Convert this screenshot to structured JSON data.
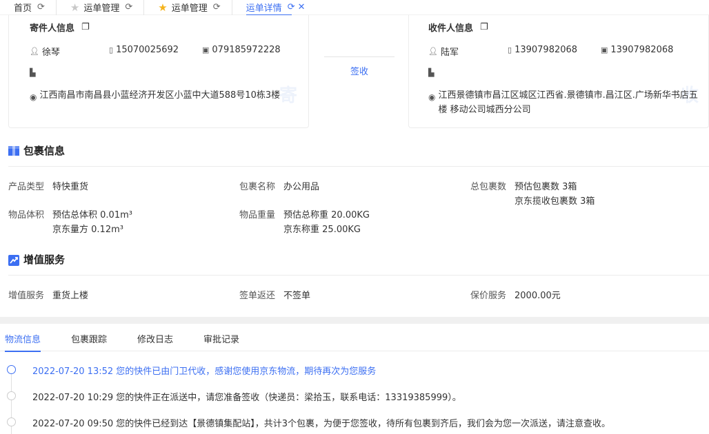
{
  "tabs": [
    {
      "label": "首页",
      "star": "none"
    },
    {
      "label": "运单管理",
      "star": "grey"
    },
    {
      "label": "运单管理",
      "star": "gold"
    },
    {
      "label": "运单详情",
      "star": "none",
      "active": true
    }
  ],
  "sender": {
    "title": "寄件人信息",
    "name": "徐琴",
    "mobile": "15070025692",
    "phone": "079185972228",
    "address": "江西南昌市南昌县小蓝经济开发区小蓝中大道588号10栋3楼",
    "watermark": "寄"
  },
  "receiver": {
    "title": "收件人信息",
    "name": "陆军",
    "mobile": "13907982068",
    "phone": "13907982068",
    "address": "江西景德镇市昌江区城区江西省.景德镇市.昌江区.广场新华书店五楼 移动公司城西分公司",
    "watermark": "收"
  },
  "status": {
    "label": "签收"
  },
  "package": {
    "title": "包裹信息",
    "product_type_k": "产品类型",
    "product_type_v": "特快重货",
    "name_k": "包裹名称",
    "name_v": "办公用品",
    "count_k": "总包裹数",
    "count_v1": "预估包裹数 3箱",
    "count_v2": "京东揽收包裹数 3箱",
    "volume_k": "物品体积",
    "volume_v1": "预估总体积 0.01m³",
    "volume_v2": "京东量方 0.12m³",
    "weight_k": "物品重量",
    "weight_v1": "预估总称重 20.00KG",
    "weight_v2": "京东称重 25.00KG"
  },
  "value_added": {
    "title": "增值服务",
    "service_k": "增值服务",
    "service_v": "重货上楼",
    "return_k": "签单返还",
    "return_v": "不签单",
    "insure_k": "保价服务",
    "insure_v": "2000.00元"
  },
  "bottom_tabs": [
    "物流信息",
    "包裹跟踪",
    "修改日志",
    "审批记录"
  ],
  "timeline": [
    {
      "text": "2022-07-20 13:52  您的快件已由门卫代收，感谢您使用京东物流，期待再次为您服务",
      "active": true
    },
    {
      "text": "2022-07-20 10:29  您的快件正在派送中，请您准备签收（快递员：梁拾玉，联系电话：13319385999）。",
      "active": false
    },
    {
      "text": "2022-07-20 09:50  您的快件已经到达【景德镇集配站】，共计3个包裹，为便于您签收，待所有包裹到齐后，我们会为您一次派送，请注意查收。",
      "active": false
    }
  ],
  "colors": {
    "accent": "#3c6ff2",
    "star": "#f5b31b"
  }
}
